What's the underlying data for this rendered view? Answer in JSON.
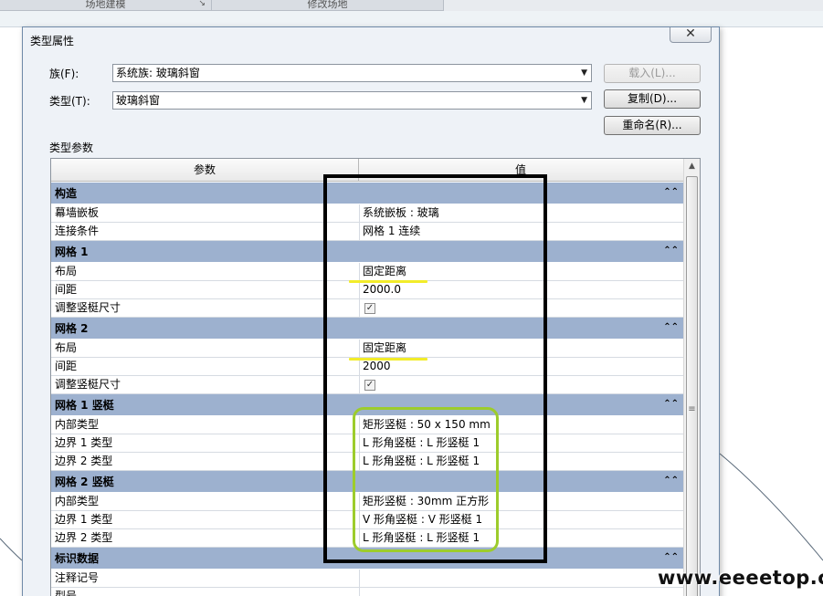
{
  "ribbon": {
    "panel1": "场地建模",
    "panel2": "修改场地"
  },
  "dialog": {
    "title": "类型属性",
    "close_glyph": "✕",
    "family_label": "族(F):",
    "family_value": "系统族: 玻璃斜窗",
    "type_label": "类型(T):",
    "type_value": "玻璃斜窗",
    "load_button": "载入(L)...",
    "duplicate_button": "复制(D)...",
    "rename_button": "重命名(R)...",
    "params_label": "类型参数"
  },
  "grid": {
    "header_param": "参数",
    "header_value": "值",
    "rows": [
      {
        "type": "group",
        "name": "构造"
      },
      {
        "type": "param",
        "name": "幕墙嵌板",
        "value": "系统嵌板 : 玻璃"
      },
      {
        "type": "param",
        "name": "连接条件",
        "value": "网格 1 连续"
      },
      {
        "type": "group",
        "name": "网格 1"
      },
      {
        "type": "param",
        "name": "布局",
        "value": "固定距离"
      },
      {
        "type": "param",
        "name": "间距",
        "value": "2000.0"
      },
      {
        "type": "check",
        "name": "调整竖梃尺寸",
        "checked": true
      },
      {
        "type": "group",
        "name": "网格 2"
      },
      {
        "type": "param",
        "name": "布局",
        "value": "固定距离"
      },
      {
        "type": "param",
        "name": "间距",
        "value": "2000"
      },
      {
        "type": "check",
        "name": "调整竖梃尺寸",
        "checked": true
      },
      {
        "type": "group",
        "name": "网格 1 竖梃"
      },
      {
        "type": "param",
        "name": "内部类型",
        "value": "矩形竖梃 : 50 x 150 mm"
      },
      {
        "type": "param",
        "name": "边界 1 类型",
        "value": "L 形角竖梃 : L 形竖梃 1"
      },
      {
        "type": "param",
        "name": "边界 2 类型",
        "value": "L 形角竖梃 : L 形竖梃 1"
      },
      {
        "type": "group",
        "name": "网格 2 竖梃"
      },
      {
        "type": "param",
        "name": "内部类型",
        "value": "矩形竖梃 : 30mm 正方形"
      },
      {
        "type": "param",
        "name": "边界 1 类型",
        "value": "V 形角竖梃 : V 形竖梃 1"
      },
      {
        "type": "param",
        "name": "边界 2 类型",
        "value": "L 形角竖梃 : L 形竖梃 1"
      },
      {
        "type": "group",
        "name": "标识数据"
      },
      {
        "type": "param",
        "name": "注释记号",
        "value": ""
      },
      {
        "type": "param",
        "name": "型号",
        "value": ""
      }
    ]
  },
  "icons": {
    "dropdown": "▼",
    "collapse": "⌃⌃",
    "check": "✓",
    "scroll_up": "▲",
    "grip": "≡"
  },
  "annotation_colors": {
    "box": "#000000",
    "highlight_box": "#9dcc2c",
    "underline": "#f2ec2a"
  },
  "watermark": "www.eeeetop.com"
}
